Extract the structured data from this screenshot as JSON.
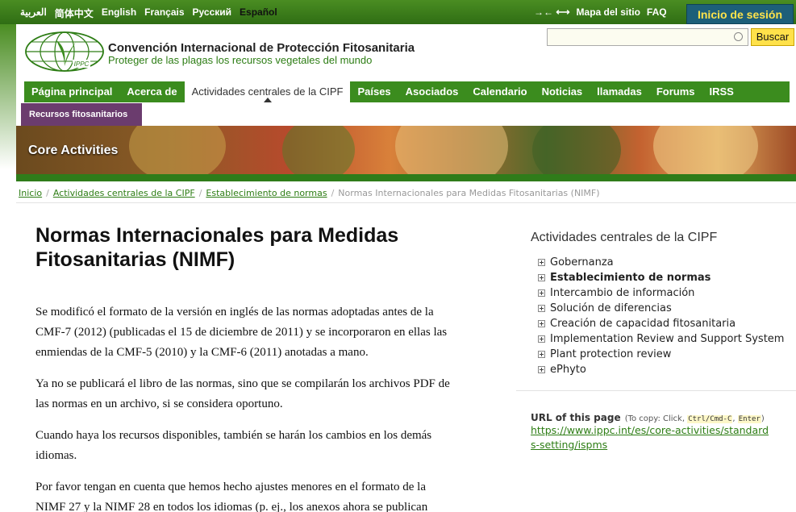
{
  "topbar": {
    "languages": [
      {
        "label": "العربية",
        "active": false
      },
      {
        "label": "简体中文",
        "active": false
      },
      {
        "label": "English",
        "active": false
      },
      {
        "label": "Français",
        "active": false
      },
      {
        "label": "Русский",
        "active": false
      },
      {
        "label": "Español",
        "active": true
      }
    ],
    "sitemap_label": "Mapa del sitio",
    "faq_label": "FAQ",
    "login_label": "Inicio de sesión"
  },
  "header": {
    "logo_text": "IPPC",
    "title": "Convención Internacional de Protección Fitosanitaria",
    "subtitle": "Proteger de las plagas los recursos vegetales del mundo"
  },
  "search": {
    "value": "",
    "button_label": "Buscar"
  },
  "nav": {
    "items": [
      {
        "label": "Página principal",
        "active": false
      },
      {
        "label": "Acerca de",
        "active": false
      },
      {
        "label": "Actividades centrales de la CIPF",
        "active": true
      },
      {
        "label": "Países",
        "active": false
      },
      {
        "label": "Asociados",
        "active": false
      },
      {
        "label": "Calendario",
        "active": false
      },
      {
        "label": "Noticias",
        "active": false
      },
      {
        "label": "llamadas",
        "active": false
      },
      {
        "label": "Forums",
        "active": false
      },
      {
        "label": "IRSS",
        "active": false
      }
    ],
    "sub_item": "Recursos fitosanitarios"
  },
  "banner": {
    "title": "Core Activities",
    "colors": {
      "accent_green": "#3b8c1e",
      "accent_purple": "#6b3c6e",
      "login_bg": "#1d5f79",
      "login_fg": "#ffe34a"
    }
  },
  "breadcrumb": {
    "links": [
      "Inicio",
      "Actividades centrales de la CIPF",
      "Establecimiento de normas"
    ],
    "current": "Normas Internacionales para Medidas Fitosanitarias (NIMF)"
  },
  "main": {
    "title": "Normas Internacionales para Medidas Fitosanitarias (NIMF)",
    "paragraphs": [
      "Se modificó el formato de la versión en inglés de las normas adoptadas antes de la CMF-7 (2012) (publicadas el 15 de diciembre de 2011) y se incorporaron en ellas las enmiendas de la CMF-5 (2010) y la CMF-6 (2011) anotadas a mano.",
      "Ya no se publicará el libro de las normas, sino que se compilarán los archivos PDF de las normas en un archivo, si se considera oportuno.",
      "Cuando haya los recursos disponibles, también se harán los cambios en los demás idiomas.",
      "Por favor tengan en cuenta que hemos hecho ajustes menores en el formato de la NIMF 27 y la NIMF 28 en todos los idiomas (p. ej., los anexos ahora se publican"
    ]
  },
  "sidebar": {
    "title": "Actividades centrales de la CIPF",
    "items": [
      {
        "label": "Gobernanza",
        "bold": false
      },
      {
        "label": "Establecimiento de normas",
        "bold": true
      },
      {
        "label": "Intercambio de información",
        "bold": false
      },
      {
        "label": "Solución de diferencias",
        "bold": false
      },
      {
        "label": "Creación de capacidad fitosanitaria",
        "bold": false
      },
      {
        "label": "Implementation Review and Support System",
        "bold": false
      },
      {
        "label": "Plant protection review",
        "bold": false
      },
      {
        "label": "ePhyto",
        "bold": false
      }
    ],
    "url_label": "URL of this page",
    "url_hint_prefix": "(To copy: Click,",
    "url_hint_key1": "Ctrl/Cmd-C",
    "url_hint_key2": "Enter",
    "url_hint_suffix": ")",
    "url": "https://www.ippc.int/es/core-activities/standards-setting/ispms"
  }
}
